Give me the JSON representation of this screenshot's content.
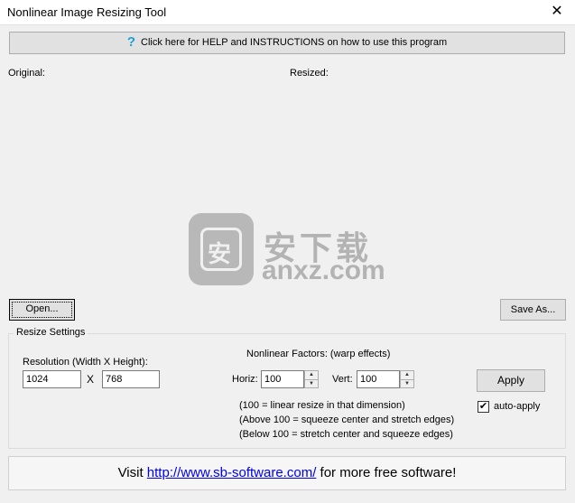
{
  "window": {
    "title": "Nonlinear Image Resizing Tool",
    "close_glyph": "✕"
  },
  "help_button": {
    "icon": "question-mark-icon",
    "icon_glyph": "?",
    "label": "Click here for HELP and INSTRUCTIONS on how to use this program"
  },
  "preview": {
    "original_label": "Original:",
    "resized_label": "Resized:"
  },
  "watermark": {
    "logo_char": "安",
    "chinese_text": "安下载",
    "url_text": "anxz.com"
  },
  "buttons": {
    "open": "Open...",
    "save_as": "Save As...",
    "apply": "Apply"
  },
  "resize_settings": {
    "group_label": "Resize Settings",
    "resolution_label": "Resolution (Width X Height):",
    "width_value": "1024",
    "separator": "X",
    "height_value": "768",
    "factors_label": "Nonlinear Factors: (warp effects)",
    "horiz_label": "Horiz:",
    "horiz_value": "100",
    "vert_label": "Vert:",
    "vert_value": "100",
    "spin_up": "▲",
    "spin_down": "▼",
    "auto_apply_label": "auto-apply",
    "auto_apply_checked": true,
    "check_glyph": "✔",
    "notes": [
      "(100 = linear  resize in that dimension)",
      "(Above 100 = squeeze center and stretch edges)",
      "(Below 100 = stretch center and squeeze edges)"
    ]
  },
  "footer": {
    "prefix": "Visit ",
    "link": "http://www.sb-software.com/",
    "suffix": " for more free software!"
  }
}
